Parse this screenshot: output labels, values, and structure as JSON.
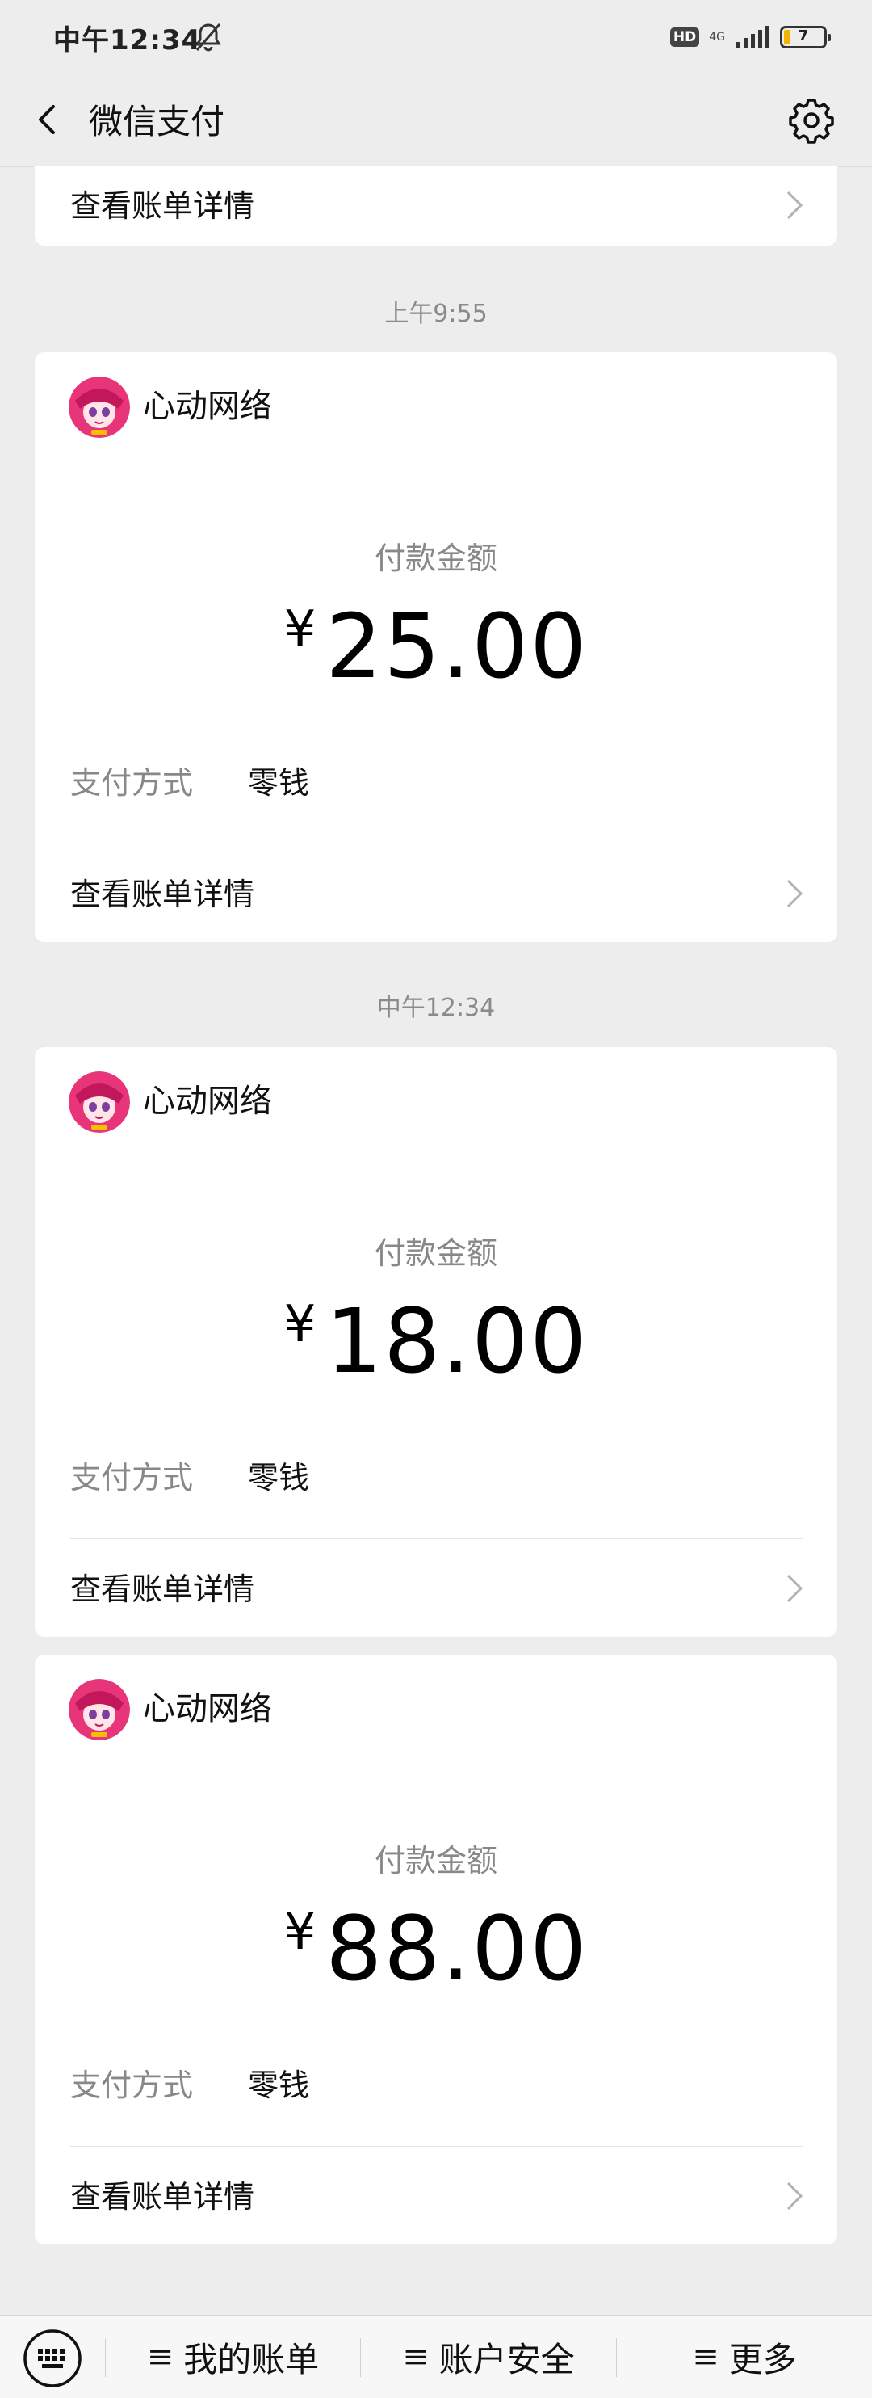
{
  "status_bar": {
    "time": "中午12:34",
    "hd": "HD",
    "network": "4G",
    "battery": "7"
  },
  "nav": {
    "title": "微信支付"
  },
  "top_card": {
    "detail_label": "查看账单详情"
  },
  "transactions": [
    {
      "timestamp": "上午9:55",
      "merchant": "心动网络",
      "amount_label": "付款金额",
      "currency": "¥",
      "amount": "25.00",
      "pay_method_label": "支付方式",
      "pay_method": "零钱",
      "detail_label": "查看账单详情"
    },
    {
      "timestamp": "中午12:34",
      "merchant": "心动网络",
      "amount_label": "付款金额",
      "currency": "¥",
      "amount": "18.00",
      "pay_method_label": "支付方式",
      "pay_method": "零钱",
      "detail_label": "查看账单详情"
    },
    {
      "merchant": "心动网络",
      "amount_label": "付款金额",
      "currency": "¥",
      "amount": "88.00",
      "pay_method_label": "支付方式",
      "pay_method": "零钱",
      "detail_label": "查看账单详情"
    }
  ],
  "bottom_bar": {
    "menu_glyph": "≡",
    "items": [
      "我的账单",
      "账户安全",
      "更多"
    ]
  },
  "colors": {
    "background": "#ededed",
    "card": "#ffffff",
    "muted_text": "#888888",
    "avatar_pink": "#e8357a"
  }
}
